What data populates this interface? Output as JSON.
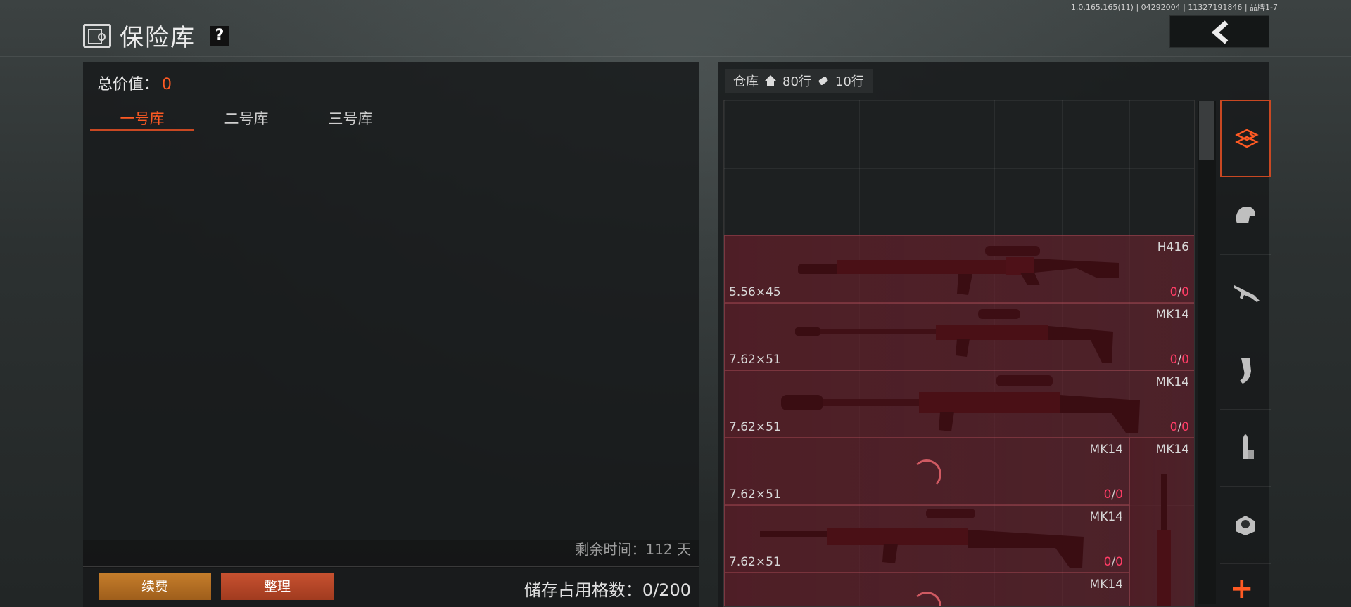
{
  "version_text": "1.0.165.165(11) | 04292004 | 11327191846 | 品牌1-7",
  "header": {
    "title": "保险库",
    "help_label": "?",
    "back_icon": "chevron-left-icon"
  },
  "vault": {
    "total_label": "总价值：",
    "total_value": "0",
    "tabs": [
      {
        "label": "一号库",
        "active": true
      },
      {
        "label": "二号库",
        "active": false
      },
      {
        "label": "三号库",
        "active": false
      }
    ],
    "remaining_label": "剩余时间：112 天",
    "renew_label": "续费",
    "sort_label": "整理",
    "capacity_label": "储存占用格数：0/200"
  },
  "warehouse": {
    "label": "仓库",
    "rows_a": "80行",
    "rows_b": "10行",
    "items": [
      {
        "name": "H416",
        "ammo": "5.56×45",
        "count_a": "0",
        "count_b": "0"
      },
      {
        "name": "MK14",
        "ammo": "7.62×51",
        "count_a": "0",
        "count_b": "0"
      },
      {
        "name": "MK14",
        "ammo": "7.62×51",
        "count_a": "0",
        "count_b": "0"
      },
      {
        "name": "MK14",
        "ammo": "7.62×51",
        "count_a": "0",
        "count_b": "0"
      },
      {
        "name": "MK14",
        "ammo": "7.62×51",
        "count_a": "0",
        "count_b": "0"
      },
      {
        "name": "MK14",
        "ammo": "",
        "count_a": "",
        "count_b": ""
      },
      {
        "name": "MK14",
        "ammo": "",
        "count_a": "",
        "count_b": ""
      }
    ]
  },
  "categories": [
    {
      "icon": "deposit-layers-icon",
      "active": true
    },
    {
      "icon": "helmet-icon",
      "active": false
    },
    {
      "icon": "rifle-icon",
      "active": false
    },
    {
      "icon": "magazine-icon",
      "active": false
    },
    {
      "icon": "ammo-icon",
      "active": false
    },
    {
      "icon": "scope-icon",
      "active": false
    }
  ],
  "add_label": "+",
  "colors": {
    "accent": "#ff5a23",
    "count": "#ff3d66",
    "item_bg": "#5f1e28"
  }
}
